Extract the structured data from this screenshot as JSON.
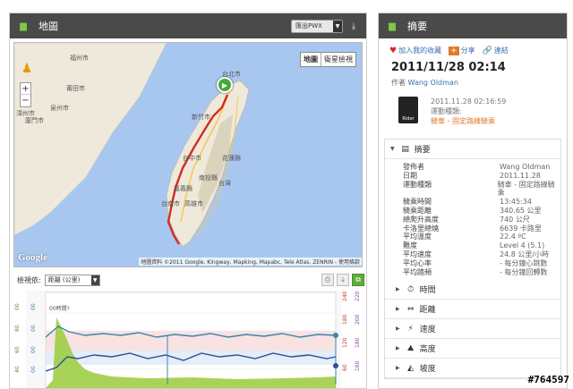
{
  "map_panel": {
    "title": "地圖",
    "export_label": "匯出PWX",
    "map_type_map": "地圖",
    "map_type_satellite": "衛星檢視",
    "google": "Google",
    "attribution": "地圖資料 ©2011 Google, Kingway, Mapking, Mapabc, Tele Atlas, ZENRIN - 使用條款",
    "labels": {
      "taipei": "台北市",
      "hsinchu": "新竹市",
      "taichung": "台中市",
      "hualien": "花蓮縣",
      "nantou": "南投縣",
      "taiwan": "台灣",
      "chiayi": "嘉義縣",
      "tainan": "台南市",
      "kaohsiung": "高雄市",
      "fuzhou": "福州市",
      "quanzhou": "泉州市",
      "xiamen": "廈門市",
      "zhangzhou": "漳州市",
      "putian": "莆田市"
    }
  },
  "chart_toolbar": {
    "label": "檢視依:",
    "axis_select": "距離 (公里)"
  },
  "chart": {
    "left_axis_1": [
      "00",
      "80",
      "60",
      "40",
      "20"
    ],
    "left_axis_2": [
      "00",
      "00",
      "00",
      "00",
      "00"
    ],
    "right_axis_1": [
      "240",
      "180",
      "120",
      "60"
    ],
    "right_axis_2": [
      "220",
      "200",
      "180",
      "160"
    ],
    "annotation": "00時間?"
  },
  "summary_panel": {
    "title": "摘要",
    "actions": {
      "favorite": "加入我的收藏",
      "share": "分享",
      "link": "連結"
    },
    "date": "2011/11/28 02:14",
    "author_prefix": "作者",
    "author_name": "Wang Oldman",
    "device_label": "Rider",
    "device_time": "2011.11.28 02:16:59",
    "sport_type_label": "運動種類:",
    "sport_type_value": "騎車 - 固定路線騎乘",
    "section_title": "摘要",
    "stats": [
      {
        "k": "發佈者",
        "v": "Wang Oldman"
      },
      {
        "k": "日期",
        "v": "2011.11.28"
      },
      {
        "k": "運動種類",
        "v": "騎車 - 固定路線騎乘"
      },
      {
        "k": "騎乘時間",
        "v": "13:45:34"
      },
      {
        "k": "騎乘距離",
        "v": "340.65 公里"
      },
      {
        "k": "總爬升高度",
        "v": "740 公尺"
      },
      {
        "k": "卡洛里總燒",
        "v": "6639 卡路里"
      },
      {
        "k": "平均溫度",
        "v": "22.4 ºC"
      },
      {
        "k": "難度",
        "v": "Level 4 (5.1)"
      },
      {
        "k": "平均速度",
        "v": "24.8 公里/小時"
      },
      {
        "k": "平均心率",
        "v": "- 每分鐘心跳數"
      },
      {
        "k": "平均踏頻",
        "v": "- 每分鐘回轉數"
      }
    ],
    "collapsed": [
      {
        "label": "時間",
        "icon": "clock-icon"
      },
      {
        "label": "距離",
        "icon": "distance-icon"
      },
      {
        "label": "速度",
        "icon": "speed-icon"
      },
      {
        "label": "高度",
        "icon": "elevation-icon"
      },
      {
        "label": "坡度",
        "icon": "grade-icon"
      }
    ]
  },
  "watermark": "#764597"
}
